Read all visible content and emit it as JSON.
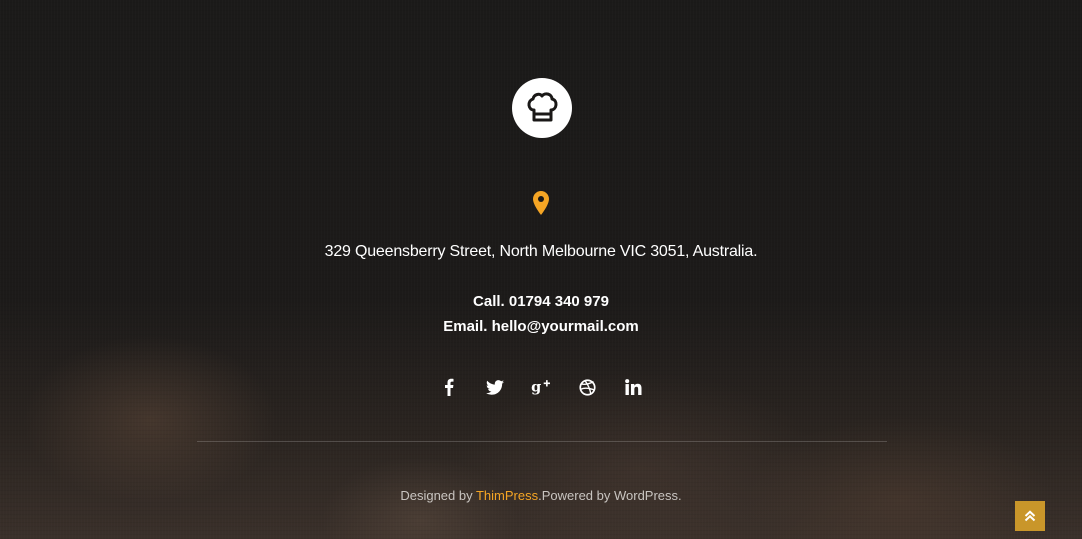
{
  "colors": {
    "background": "#1a1817",
    "accent": "#f5a524",
    "back_to_top_bg": "#c9962a",
    "text": "#ffffff",
    "muted_text": "#c8c4c0"
  },
  "logo": {
    "icon": "chef-hat-icon"
  },
  "location": {
    "icon": "map-pin-icon",
    "address": "329 Queensberry Street, North Melbourne VIC 3051, Australia."
  },
  "contact": {
    "call": "Call. 01794 340 979",
    "email": "Email. hello@yourmail.com"
  },
  "social": [
    {
      "name": "facebook",
      "icon": "facebook-icon"
    },
    {
      "name": "twitter",
      "icon": "twitter-icon"
    },
    {
      "name": "google-plus",
      "icon": "google-plus-icon"
    },
    {
      "name": "dribbble",
      "icon": "dribbble-icon"
    },
    {
      "name": "linkedin",
      "icon": "linkedin-icon"
    }
  ],
  "credits": {
    "prefix": "Designed by ",
    "brand": "ThimPress",
    "suffix": ".Powered by WordPress."
  },
  "back_to_top": {
    "icon": "double-chevron-up-icon"
  }
}
